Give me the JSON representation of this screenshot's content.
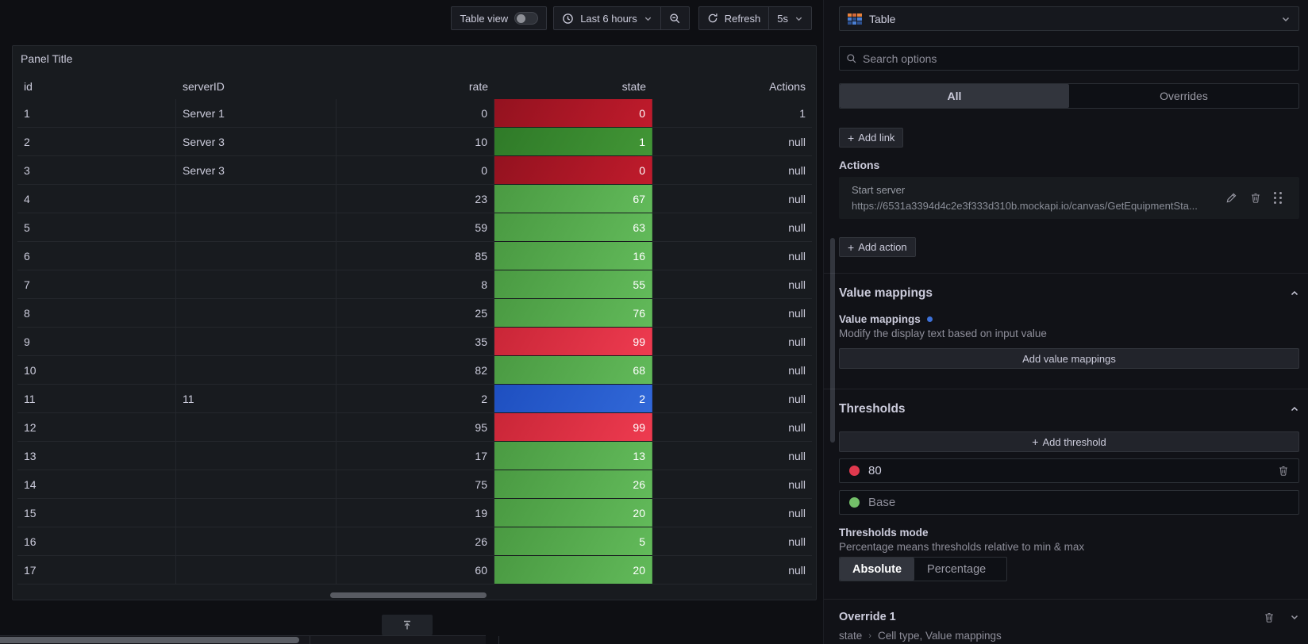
{
  "toolbar": {
    "table_view_label": "Table view",
    "time_range_label": "Last 6 hours",
    "refresh_label": "Refresh",
    "refresh_interval": "5s"
  },
  "panel": {
    "title": "Panel Title",
    "table": {
      "columns": [
        {
          "label": "id",
          "align": "left"
        },
        {
          "label": "serverID",
          "align": "left"
        },
        {
          "label": "rate",
          "align": "right"
        },
        {
          "label": "state",
          "align": "right"
        },
        {
          "label": "Actions",
          "align": "right"
        }
      ],
      "rows": [
        {
          "id": "1",
          "serverID": "Server 1",
          "rate": "0",
          "state": "0",
          "actions": "1",
          "state_color": "dark_red"
        },
        {
          "id": "2",
          "serverID": "Server 3",
          "rate": "10",
          "state": "1",
          "actions": "null",
          "state_color": "dark_green"
        },
        {
          "id": "3",
          "serverID": "Server 3",
          "rate": "0",
          "state": "0",
          "actions": "null",
          "state_color": "dark_red"
        },
        {
          "id": "4",
          "serverID": "",
          "rate": "23",
          "state": "67",
          "actions": "null",
          "state_color": "green"
        },
        {
          "id": "5",
          "serverID": "",
          "rate": "59",
          "state": "63",
          "actions": "null",
          "state_color": "green"
        },
        {
          "id": "6",
          "serverID": "",
          "rate": "85",
          "state": "16",
          "actions": "null",
          "state_color": "green"
        },
        {
          "id": "7",
          "serverID": "",
          "rate": "8",
          "state": "55",
          "actions": "null",
          "state_color": "green"
        },
        {
          "id": "8",
          "serverID": "",
          "rate": "25",
          "state": "76",
          "actions": "null",
          "state_color": "green"
        },
        {
          "id": "9",
          "serverID": "",
          "rate": "35",
          "state": "99",
          "actions": "null",
          "state_color": "red"
        },
        {
          "id": "10",
          "serverID": "",
          "rate": "82",
          "state": "68",
          "actions": "null",
          "state_color": "green"
        },
        {
          "id": "11",
          "serverID": "11",
          "rate": "2",
          "state": "2",
          "actions": "null",
          "state_color": "blue"
        },
        {
          "id": "12",
          "serverID": "",
          "rate": "95",
          "state": "99",
          "actions": "null",
          "state_color": "red"
        },
        {
          "id": "13",
          "serverID": "",
          "rate": "17",
          "state": "13",
          "actions": "null",
          "state_color": "green"
        },
        {
          "id": "14",
          "serverID": "",
          "rate": "75",
          "state": "26",
          "actions": "null",
          "state_color": "green"
        },
        {
          "id": "15",
          "serverID": "",
          "rate": "19",
          "state": "20",
          "actions": "null",
          "state_color": "green"
        },
        {
          "id": "16",
          "serverID": "",
          "rate": "26",
          "state": "5",
          "actions": "null",
          "state_color": "green"
        },
        {
          "id": "17",
          "serverID": "",
          "rate": "60",
          "state": "20",
          "actions": "null",
          "state_color": "green"
        }
      ],
      "state_cell_gradients": {
        "green": {
          "from": "#4a9a42",
          "to": "#62ba5a"
        },
        "red": {
          "from": "#c92637",
          "to": "#ee3b50"
        },
        "blue": {
          "from": "#1e4fc0",
          "to": "#3168d8"
        },
        "dark_red": {
          "from": "#93121f",
          "to": "#c01b2c"
        },
        "dark_green": {
          "from": "#2f7a28",
          "to": "#429636"
        }
      }
    }
  },
  "options_pane": {
    "visualization": {
      "name": "Table"
    },
    "search": {
      "placeholder": "Search options"
    },
    "tabs": [
      {
        "label": "All",
        "selected": true
      },
      {
        "label": "Overrides",
        "selected": false
      }
    ],
    "links": {
      "add_link_label": "Add link"
    },
    "actions": {
      "label": "Actions",
      "item": {
        "title": "Start server",
        "url": "https://6531a3394d4c2e3f333d310b.mockapi.io/canvas/GetEquipmentSta..."
      },
      "add_action_label": "Add action"
    },
    "value_mappings": {
      "section_title": "Value mappings",
      "field_label": "Value mappings",
      "description": "Modify the display text based on input value",
      "add_button_label": "Add value mappings"
    },
    "thresholds": {
      "section_title": "Thresholds",
      "add_button_label": "Add threshold",
      "threshold_value": "80",
      "threshold_color": "#e0394e",
      "base_label": "Base",
      "base_color": "#73bf69",
      "mode_label": "Thresholds mode",
      "mode_description": "Percentage means thresholds relative to min & max",
      "mode_options": [
        {
          "label": "Absolute",
          "selected": true
        },
        {
          "label": "Percentage",
          "selected": false
        }
      ]
    },
    "override": {
      "title": "Override 1",
      "target": "state",
      "properties": "Cell type, Value mappings"
    }
  }
}
